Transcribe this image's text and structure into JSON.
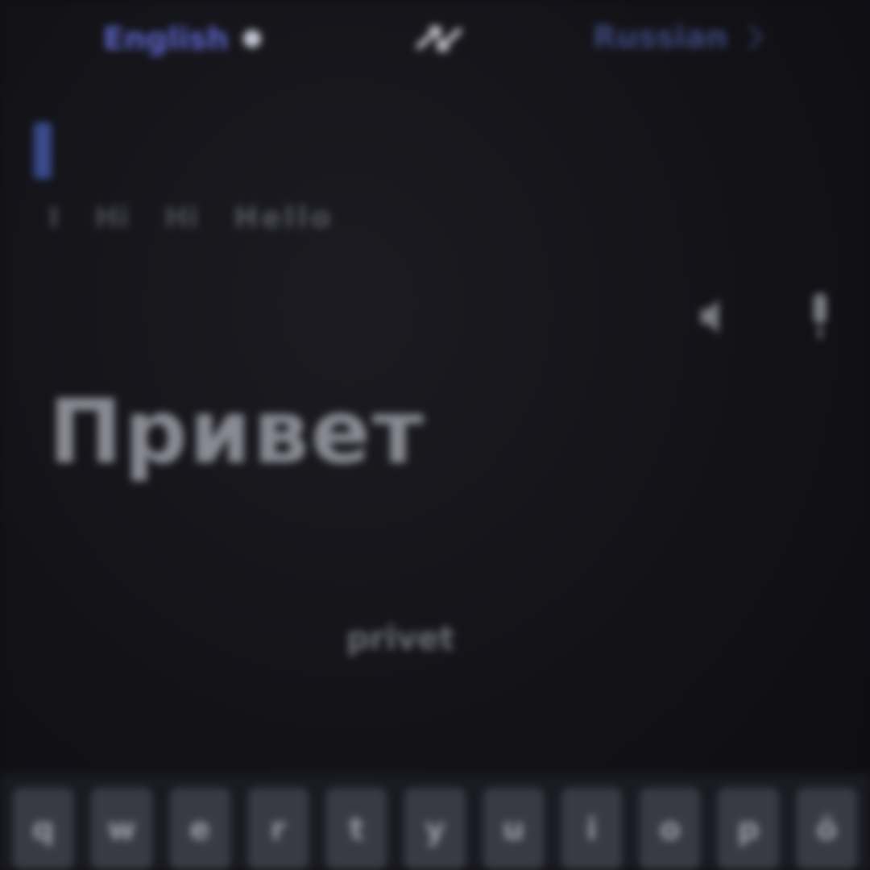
{
  "top_bar": {
    "source_language": "English",
    "target_language": "Russian"
  },
  "suggestions": [
    "I",
    "Hi",
    "Hi",
    "Hello"
  ],
  "translation": {
    "text": "Привет",
    "romanization": "privet"
  },
  "keyboard": {
    "keys": [
      "q",
      "w",
      "e",
      "r",
      "t",
      "y",
      "u",
      "i",
      "o",
      "p",
      "ö"
    ]
  },
  "colors": {
    "accent": "#5b63c4",
    "background": "#121217"
  },
  "icons": [
    "dot-icon",
    "swap-icon",
    "chevron-down-icon",
    "speaker-icon",
    "mic-icon"
  ]
}
